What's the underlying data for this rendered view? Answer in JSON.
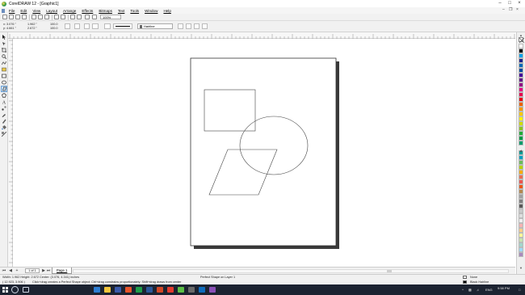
{
  "window": {
    "title": "CorelDRAW 12 - [Graphic1]"
  },
  "menu": {
    "items": [
      "File",
      "Edit",
      "View",
      "Layout",
      "Arrange",
      "Effects",
      "Bitmaps",
      "Text",
      "Tools",
      "Window",
      "Help"
    ]
  },
  "toolbar": {
    "zoom_value": "100%"
  },
  "property_bar": {
    "x": "x: 3.076 \"",
    "y": "y: 4.661 \"",
    "w": "1.962 \"",
    "h": "2.672 \"",
    "scale_x": "100.0",
    "scale_y": "100.0",
    "outline_width": "Hairline"
  },
  "navigator": {
    "page_count": "1 of 1",
    "page_tab": "Page 1"
  },
  "status": {
    "dimensions": "Width: 1.962  Height: 2.672  Center: (3.076, 4.341)  inches",
    "shape_info": "Perfect Shape on Layer 1",
    "coordinates": "( 12.923, 3.906 )",
    "hint": "Click+drag creates a Perfect Shape object; Ctrl+drag constrains proportionately; Shift+drag draws from center",
    "fill_label": "None",
    "outline_label": "Black  Hairline"
  },
  "tray": {
    "language": "ENG",
    "time": "9:58 PM"
  },
  "colors": {
    "palette": [
      "#ffffff",
      "#000000",
      "#00a0e9",
      "#1d2088",
      "#0068b7",
      "#00479d",
      "#440099",
      "#601986",
      "#920783",
      "#e4007f",
      "#e5004f",
      "#e60012",
      "#eb6100",
      "#f39800",
      "#fcc800",
      "#fff100",
      "#cfdb00",
      "#8fc31f",
      "#22ac38",
      "#009944",
      "#009b6b",
      "#009e96",
      "#00a0c1",
      "#6cbb5a",
      "#b8d200",
      "#f7ab00",
      "#ec6d51",
      "#ea5550",
      "#ea5514",
      "#b28850",
      "#a0a0a0",
      "#7f7f7f",
      "#595757",
      "#c9caca",
      "#dcdddd",
      "#eeeeef",
      "#f5b2b2",
      "#facd89",
      "#fff799",
      "#c7e2b1",
      "#a3d6cc",
      "#9fd9f6",
      "#aa89bd"
    ]
  }
}
